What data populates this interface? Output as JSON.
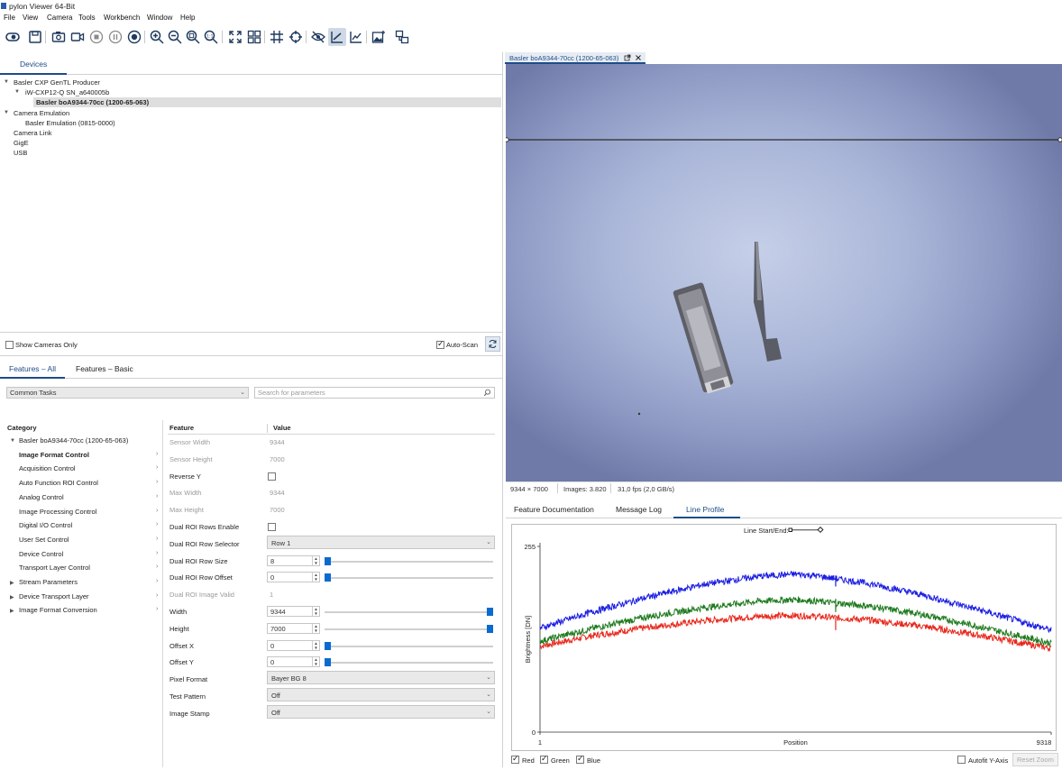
{
  "window": {
    "title": "pylon Viewer 64-Bit"
  },
  "menu": [
    "File",
    "View",
    "Camera",
    "Tools",
    "Workbench",
    "Window",
    "Help"
  ],
  "toolbar": {
    "icons": [
      "open-icon",
      "save-icon",
      "snapshot-icon",
      "record-video-icon",
      "stop-icon",
      "pause-icon",
      "continuous-shot-icon",
      "zoom-in-icon",
      "zoom-out-icon",
      "zoom-fit-icon",
      "zoom-100-icon",
      "fullscreen-icon",
      "tile-icon",
      "grid-icon",
      "crosshair-icon",
      "hide-icon",
      "line-profile-icon",
      "histogram-icon",
      "image-add-icon",
      "layout-icon"
    ]
  },
  "devices": {
    "tab_label": "Devices",
    "tree": [
      {
        "label": "Basler CXP GenTL Producer",
        "level": 0,
        "expanded": true
      },
      {
        "label": "iW-CXP12-Q SN_a640005b",
        "level": 1,
        "expanded": true
      },
      {
        "label": "Basler boA9344-70cc (1200-65-063)",
        "level": 2,
        "selected": true
      },
      {
        "label": "Camera Emulation",
        "level": 0,
        "expanded": true
      },
      {
        "label": "Basler Emulation (0815-0000)",
        "level": 1
      },
      {
        "label": "Camera Link",
        "level": 0
      },
      {
        "label": "GigE",
        "level": 0
      },
      {
        "label": "USB",
        "level": 0
      }
    ],
    "show_cameras_only": "Show Cameras Only",
    "auto_scan": "Auto-Scan"
  },
  "features": {
    "tabs": [
      "Features – All",
      "Features – Basic"
    ],
    "task_select": "Common Tasks",
    "search_placeholder": "Search for parameters",
    "headers": {
      "category": "Category",
      "feature": "Feature",
      "value": "Value"
    },
    "categories": [
      {
        "label": "Basler boA9344-70cc (1200-65-063)",
        "root": true
      },
      {
        "label": "Image Format Control",
        "bold": true
      },
      {
        "label": "Acquisition Control"
      },
      {
        "label": "Auto Function ROI Control"
      },
      {
        "label": "Analog Control"
      },
      {
        "label": "Image Processing Control"
      },
      {
        "label": "Digital I/O Control"
      },
      {
        "label": "User Set Control"
      },
      {
        "label": "Device Control"
      },
      {
        "label": "Transport Layer Control"
      },
      {
        "label": "Stream Parameters",
        "root2": true
      },
      {
        "label": "Device Transport Layer",
        "root2": true
      },
      {
        "label": "Image Format Conversion",
        "root2": true
      }
    ],
    "rows": [
      {
        "name": "Sensor Width",
        "value": "9344",
        "kind": "ro"
      },
      {
        "name": "Sensor Height",
        "value": "7000",
        "kind": "ro"
      },
      {
        "name": "Reverse Y",
        "value": "",
        "kind": "check"
      },
      {
        "name": "Max Width",
        "value": "9344",
        "kind": "ro"
      },
      {
        "name": "Max Height",
        "value": "7000",
        "kind": "ro"
      },
      {
        "name": "Dual ROI Rows Enable",
        "value": "",
        "kind": "check"
      },
      {
        "name": "Dual ROI Row Selector",
        "value": "Row 1",
        "kind": "select"
      },
      {
        "name": "Dual ROI Row Size",
        "value": "8",
        "kind": "spin",
        "level": 0.0
      },
      {
        "name": "Dual ROI Row Offset",
        "value": "0",
        "kind": "spin",
        "level": 0.0
      },
      {
        "name": "Dual ROI Image Valid",
        "value": "1",
        "kind": "ro"
      },
      {
        "name": "Width",
        "value": "9344",
        "kind": "spin",
        "level": 1.0
      },
      {
        "name": "Height",
        "value": "7000",
        "kind": "spin",
        "level": 1.0
      },
      {
        "name": "Offset X",
        "value": "0",
        "kind": "spin",
        "level": 0.0
      },
      {
        "name": "Offset Y",
        "value": "0",
        "kind": "spin",
        "level": 0.0
      },
      {
        "name": "Pixel Format",
        "value": "Bayer BG 8",
        "kind": "select"
      },
      {
        "name": "Test Pattern",
        "value": "Off",
        "kind": "select"
      },
      {
        "name": "Image Stamp",
        "value": "Off",
        "kind": "select"
      }
    ]
  },
  "viewer": {
    "doc_tab": "Basler boA9344-70cc (1200-65-063)",
    "status": {
      "resolution": "9344 × 7000",
      "images": "Images: 3.820",
      "fps": "31,0 fps  (2,0 GB/s)"
    }
  },
  "bottom": {
    "tabs": [
      "Feature Documentation",
      "Message Log",
      "Line Profile"
    ],
    "selected": "Line Profile"
  },
  "chart_data": {
    "type": "line",
    "title": "Line Start/End:",
    "xlabel": "Position",
    "ylabel": "Brightness [DN]",
    "xlim": [
      1,
      9318
    ],
    "ylim": [
      0,
      255
    ],
    "x_tick_labels": [
      "1",
      "Position",
      "9318"
    ],
    "y_tick_labels": [
      "255",
      "0"
    ],
    "series": [
      {
        "name": "Red",
        "color": "#e8281c",
        "x": [
          1,
          1000,
          2000,
          3000,
          4000,
          4659,
          5000,
          6000,
          7000,
          8000,
          9318
        ],
        "y": [
          118,
          133,
          144,
          153,
          159,
          160,
          159,
          154,
          145,
          133,
          115
        ]
      },
      {
        "name": "Green",
        "color": "#1e7a1e",
        "x": [
          1,
          1000,
          2000,
          3000,
          4000,
          4659,
          5000,
          6000,
          7000,
          8000,
          9318
        ],
        "y": [
          125,
          143,
          159,
          171,
          180,
          182,
          180,
          173,
          161,
          145,
          122
        ]
      },
      {
        "name": "Blue",
        "color": "#1c1ee0",
        "x": [
          1,
          1000,
          2000,
          3000,
          4000,
          4659,
          5000,
          6000,
          7000,
          8000,
          9318
        ],
        "y": [
          143,
          166,
          186,
          203,
          214,
          217,
          215,
          204,
          188,
          168,
          140
        ]
      }
    ]
  },
  "plot_footer": {
    "checks": [
      "Red",
      "Green",
      "Blue"
    ],
    "autofit": "Autofit Y-Axis",
    "reset_zoom": "Reset Zoom"
  }
}
